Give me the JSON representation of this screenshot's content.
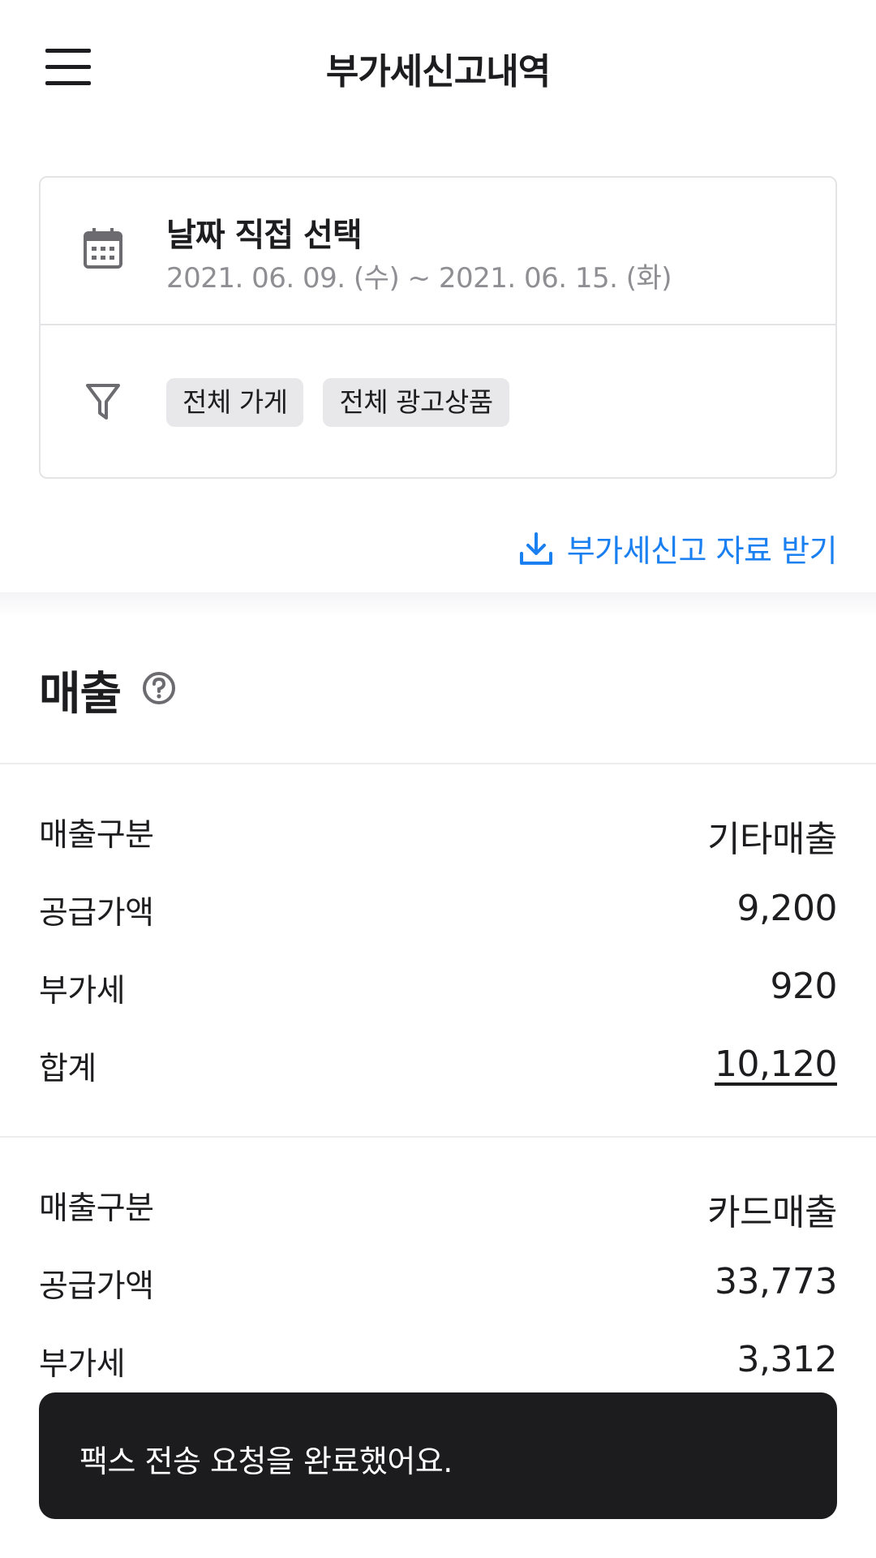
{
  "header": {
    "title": "부가세신고내역",
    "menu_icon": "hamburger-menu-icon"
  },
  "filter": {
    "date_label": "날짜 직접 선택",
    "date_range": "2021. 06. 09. (수) ~ 2021. 06. 15. (화)",
    "date_icon": "calendar-icon",
    "filter_icon": "funnel-icon",
    "chips": [
      "전체 가게",
      "전체 광고상품"
    ]
  },
  "download": {
    "label": "부가세신고 자료 받기",
    "icon": "download-icon",
    "color": "#1a7ff0"
  },
  "section": {
    "title": "매출",
    "help_icon": "question-circle-icon"
  },
  "groups": [
    {
      "rows": [
        {
          "label": "매출구분",
          "value": "기타매출"
        },
        {
          "label": "공급가액",
          "value": "9,200"
        },
        {
          "label": "부가세",
          "value": "920"
        },
        {
          "label": "합계",
          "value": "10,120"
        }
      ]
    },
    {
      "rows": [
        {
          "label": "매출구분",
          "value": "카드매출"
        },
        {
          "label": "공급가액",
          "value": "33,773"
        },
        {
          "label": "부가세",
          "value": "3,312"
        }
      ]
    }
  ],
  "toast": {
    "message": "팩스 전송 요청을 완료했어요."
  }
}
